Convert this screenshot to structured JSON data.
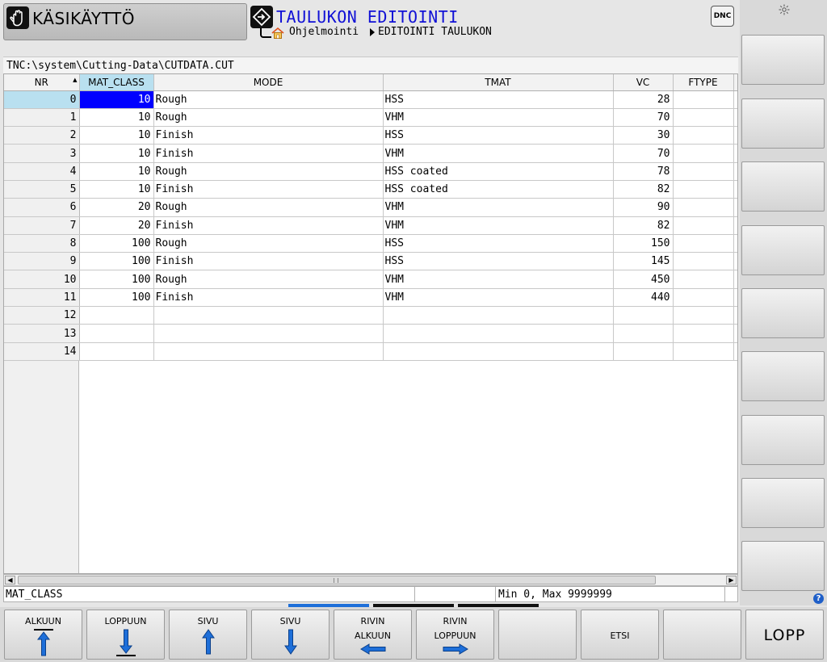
{
  "header": {
    "mode_manual": "KÄSIKÄYTTÖ",
    "mode_edit": "TAULUKON EDITOINTI",
    "breadcrumb": [
      "Ohjelmointi",
      "EDITOINTI TAULUKON"
    ],
    "dnc_label": "DNC"
  },
  "file_path": "TNC:\\system\\Cutting-Data\\CUTDATA.CUT",
  "table": {
    "columns": [
      "NR",
      "MAT_CLASS",
      "MODE",
      "TMAT",
      "VC",
      "FTYPE"
    ],
    "rows": [
      {
        "nr": "0",
        "mat_class": "10",
        "mode": "Rough",
        "tmat": "HSS",
        "vc": "28",
        "ftype": ""
      },
      {
        "nr": "1",
        "mat_class": "10",
        "mode": "Rough",
        "tmat": "VHM",
        "vc": "70",
        "ftype": ""
      },
      {
        "nr": "2",
        "mat_class": "10",
        "mode": "Finish",
        "tmat": "HSS",
        "vc": "30",
        "ftype": ""
      },
      {
        "nr": "3",
        "mat_class": "10",
        "mode": "Finish",
        "tmat": "VHM",
        "vc": "70",
        "ftype": ""
      },
      {
        "nr": "4",
        "mat_class": "10",
        "mode": "Rough",
        "tmat": "HSS coated",
        "vc": "78",
        "ftype": ""
      },
      {
        "nr": "5",
        "mat_class": "10",
        "mode": "Finish",
        "tmat": "HSS coated",
        "vc": "82",
        "ftype": ""
      },
      {
        "nr": "6",
        "mat_class": "20",
        "mode": "Rough",
        "tmat": "VHM",
        "vc": "90",
        "ftype": ""
      },
      {
        "nr": "7",
        "mat_class": "20",
        "mode": "Finish",
        "tmat": "VHM",
        "vc": "82",
        "ftype": ""
      },
      {
        "nr": "8",
        "mat_class": "100",
        "mode": "Rough",
        "tmat": "HSS",
        "vc": "150",
        "ftype": ""
      },
      {
        "nr": "9",
        "mat_class": "100",
        "mode": "Finish",
        "tmat": "HSS",
        "vc": "145",
        "ftype": ""
      },
      {
        "nr": "10",
        "mat_class": "100",
        "mode": "Rough",
        "tmat": "VHM",
        "vc": "450",
        "ftype": ""
      },
      {
        "nr": "11",
        "mat_class": "100",
        "mode": "Finish",
        "tmat": "VHM",
        "vc": "440",
        "ftype": ""
      },
      {
        "nr": "12",
        "mat_class": "",
        "mode": "",
        "tmat": "",
        "vc": "",
        "ftype": ""
      },
      {
        "nr": "13",
        "mat_class": "",
        "mode": "",
        "tmat": "",
        "vc": "",
        "ftype": ""
      },
      {
        "nr": "14",
        "mat_class": "",
        "mode": "",
        "tmat": "",
        "vc": "",
        "ftype": ""
      }
    ]
  },
  "status": {
    "field_name": "MAT_CLASS",
    "middle": "",
    "range": "Min 0, Max 9999999"
  },
  "softkeys": {
    "alkuun": "ALKUUN",
    "loppuun": "LOPPUUN",
    "sivu_up": "SIVU",
    "sivu_down": "SIVU",
    "rivin_alkuun_1": "RIVIN",
    "rivin_alkuun_2": "ALKUUN",
    "rivin_loppuun_1": "RIVIN",
    "rivin_loppuun_2": "LOPPUUN",
    "etsi": "ETSI",
    "lopp": "LOPP"
  },
  "help_label": "?",
  "colors": {
    "selection": "#0000ff",
    "active_header": "#b9e0f0",
    "title_blue": "#1010d6",
    "arrow_blue": "#1e6fd9"
  }
}
